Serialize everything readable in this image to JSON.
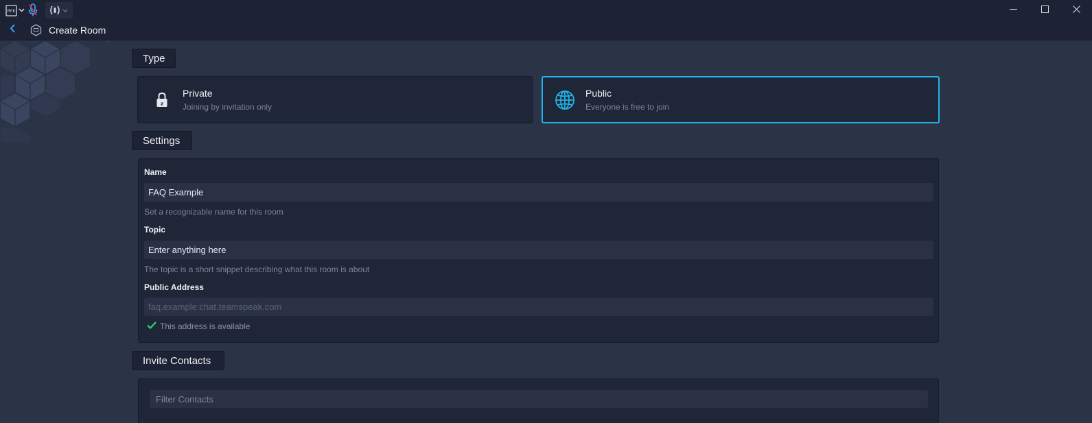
{
  "titlebar": {
    "app_icon": "bookmark-rfk-icon",
    "mic_icon": "microphone-icon",
    "ptt_icon": "push-to-talk-icon",
    "window_controls": [
      "minimize-icon",
      "maximize-icon",
      "close-icon"
    ]
  },
  "header": {
    "back_icon": "chevron-left-icon",
    "room_icon": "room-hex-icon",
    "title": "Create Room"
  },
  "type_section": {
    "heading": "Type",
    "options": [
      {
        "title": "Private",
        "subtitle": "Joining by invitation only",
        "icon": "lock-icon",
        "selected": false
      },
      {
        "title": "Public",
        "subtitle": "Everyone is free to join",
        "icon": "globe-icon",
        "selected": true
      }
    ]
  },
  "settings_section": {
    "heading": "Settings",
    "name": {
      "label": "Name",
      "value": "FAQ Example",
      "help": "Set a recognizable name for this room"
    },
    "topic": {
      "label": "Topic",
      "value": "Enter anything here",
      "help": "The topic is a short snippet describing what this room is about"
    },
    "address": {
      "label": "Public Address",
      "placeholder": "faq.example:chat.teamspeak.com",
      "status": "This address is available",
      "status_icon": "checkmark-icon"
    }
  },
  "invite_section": {
    "heading": "Invite Contacts",
    "filter_placeholder": "Filter Contacts"
  },
  "colors": {
    "background": "#2b3346",
    "panel": "#1f2637",
    "accent": "#21b3e8",
    "success": "#2ed47a"
  }
}
